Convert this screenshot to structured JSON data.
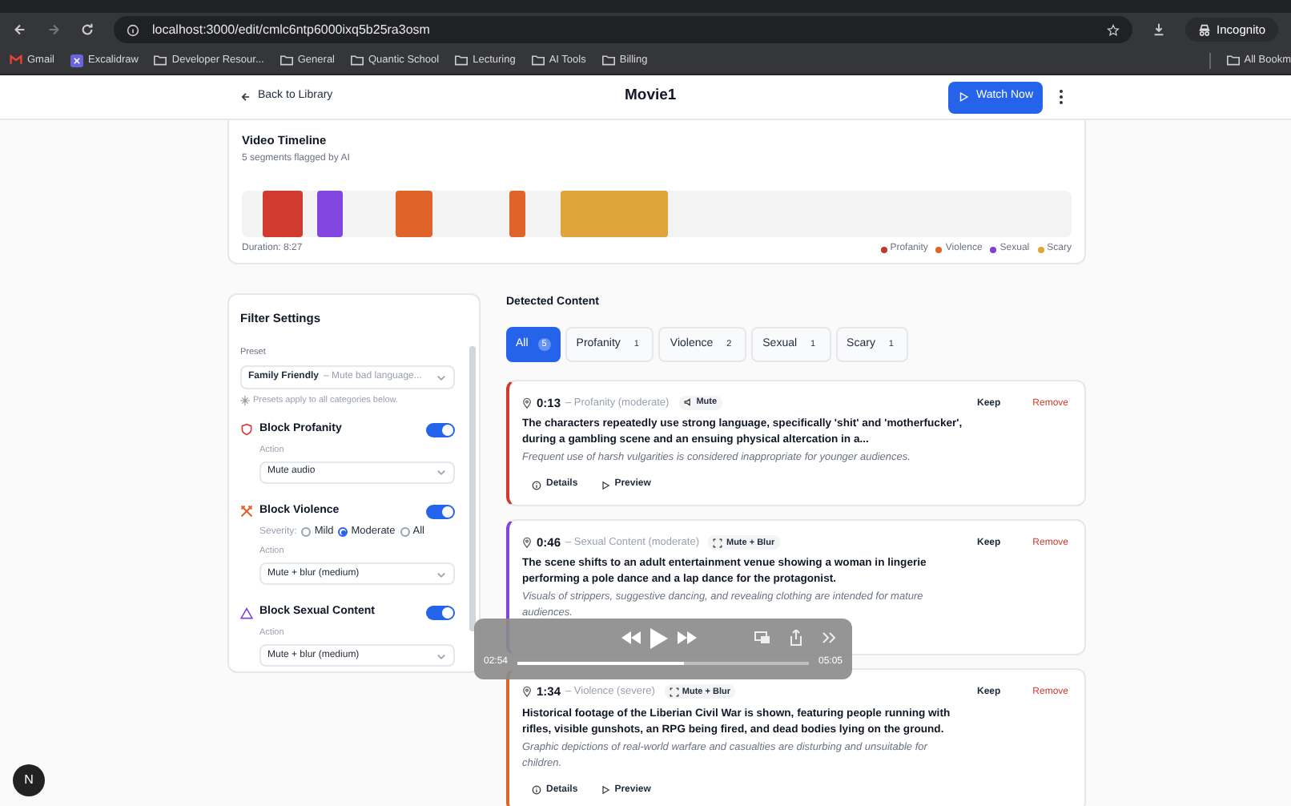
{
  "browser": {
    "url": "localhost:3000/edit/cmlc6ntp6000ixq5b25ra3osm",
    "profile": "Incognito",
    "bookmarks": [
      {
        "label": "Gmail",
        "kind": "gmail"
      },
      {
        "label": "Excalidraw",
        "kind": "excalidraw"
      },
      {
        "label": "Developer Resour...",
        "kind": "folder"
      },
      {
        "label": "General",
        "kind": "folder"
      },
      {
        "label": "Quantic School",
        "kind": "folder"
      },
      {
        "label": "Lecturing",
        "kind": "folder"
      },
      {
        "label": "AI Tools",
        "kind": "folder"
      },
      {
        "label": "Billing",
        "kind": "folder"
      }
    ],
    "all_bookmarks": "All Bookm"
  },
  "header": {
    "back": "Back to Library",
    "title": "Movie1",
    "watch": "Watch Now"
  },
  "timeline": {
    "title": "Video Timeline",
    "subtitle": "5 segments flagged by AI",
    "segments": [
      {
        "color": "#d03a2f"
      },
      {
        "color": "#8345e0"
      },
      {
        "color": "#e0642a"
      },
      {
        "color": "#e0642a"
      },
      {
        "color": "#dfa53b"
      }
    ],
    "duration": "Duration: 8:27",
    "legend": [
      {
        "label": "Profanity",
        "color": "#c0392b"
      },
      {
        "label": "Violence",
        "color": "#e0642a"
      },
      {
        "label": "Sexual",
        "color": "#7e3fdc"
      },
      {
        "label": "Scary",
        "color": "#dfa53b"
      }
    ]
  },
  "filters": {
    "title": "Filter Settings",
    "preset_label": "Preset",
    "preset": {
      "name": "Family Friendly",
      "hint": "– Mute bad language..."
    },
    "preset_note": "Presets apply to all categories below.",
    "categories": [
      {
        "kind": "shield",
        "title": "Block Profanity",
        "on": true,
        "action_label": "Action",
        "action": "Mute audio"
      },
      {
        "kind": "swords",
        "title": "Block Violence",
        "on": true,
        "severity": {
          "label": "Severity:",
          "options": [
            {
              "label": "Mild",
              "selected": false
            },
            {
              "label": "Moderate",
              "selected": true
            },
            {
              "label": "All",
              "selected": false
            }
          ]
        },
        "action_label": "Action",
        "action": "Mute + blur (medium)"
      },
      {
        "kind": "triangle",
        "title": "Block Sexual Content",
        "on": true,
        "action_label": "Action",
        "action": "Mute + blur (medium)"
      }
    ]
  },
  "content": {
    "title": "Detected Content",
    "chips": [
      {
        "label": "All",
        "count": "5",
        "selected": true
      },
      {
        "label": "Profanity",
        "count": "1",
        "selected": false
      },
      {
        "label": "Violence",
        "count": "2",
        "selected": false
      },
      {
        "label": "Sexual",
        "count": "1",
        "selected": false
      },
      {
        "label": "Scary",
        "count": "1",
        "selected": false
      }
    ],
    "cards": [
      {
        "color": "#d03a2f",
        "time": "0:13",
        "category": "– Profanity (moderate)",
        "action": {
          "kind": "mute",
          "label": "Mute"
        },
        "description": "The characters repeatedly use strong language, specifically 'shit' and 'motherfucker', during a gambling scene and an ensuing physical altercation in a...",
        "reason": "Frequent use of harsh vulgarities is considered inappropriate for younger audiences.",
        "keep": "Keep",
        "remove": "Remove",
        "links": [
          {
            "kind": "details",
            "label": "Details"
          },
          {
            "kind": "preview",
            "label": "Preview"
          }
        ]
      },
      {
        "color": "#8345e0",
        "time": "0:46",
        "category": "– Sexual Content (moderate)",
        "action": {
          "kind": "blur",
          "label": "Mute + Blur"
        },
        "description": "The scene shifts to an adult entertainment venue showing a woman in lingerie performing a pole dance and a lap dance for the protagonist.",
        "reason": "Visuals of strippers, suggestive dancing, and revealing clothing are intended for mature audiences.",
        "keep": "Keep",
        "remove": "Remove"
      },
      {
        "color": "#e0642a",
        "time": "1:34",
        "category": "– Violence (severe)",
        "action": {
          "kind": "blur",
          "label": "Mute + Blur"
        },
        "description": "Historical footage of the Liberian Civil War is shown, featuring people running with rifles, visible gunshots, an RPG being fired, and dead bodies lying on the ground.",
        "reason": "Graphic depictions of real-world warfare and casualties are disturbing and unsuitable for children.",
        "keep": "Keep",
        "remove": "Remove",
        "links": [
          {
            "kind": "details",
            "label": "Details"
          },
          {
            "kind": "preview",
            "label": "Preview"
          }
        ]
      }
    ]
  },
  "player": {
    "elapsed": "02:54",
    "total": "05:05",
    "level": 0.57
  },
  "fab": "N"
}
